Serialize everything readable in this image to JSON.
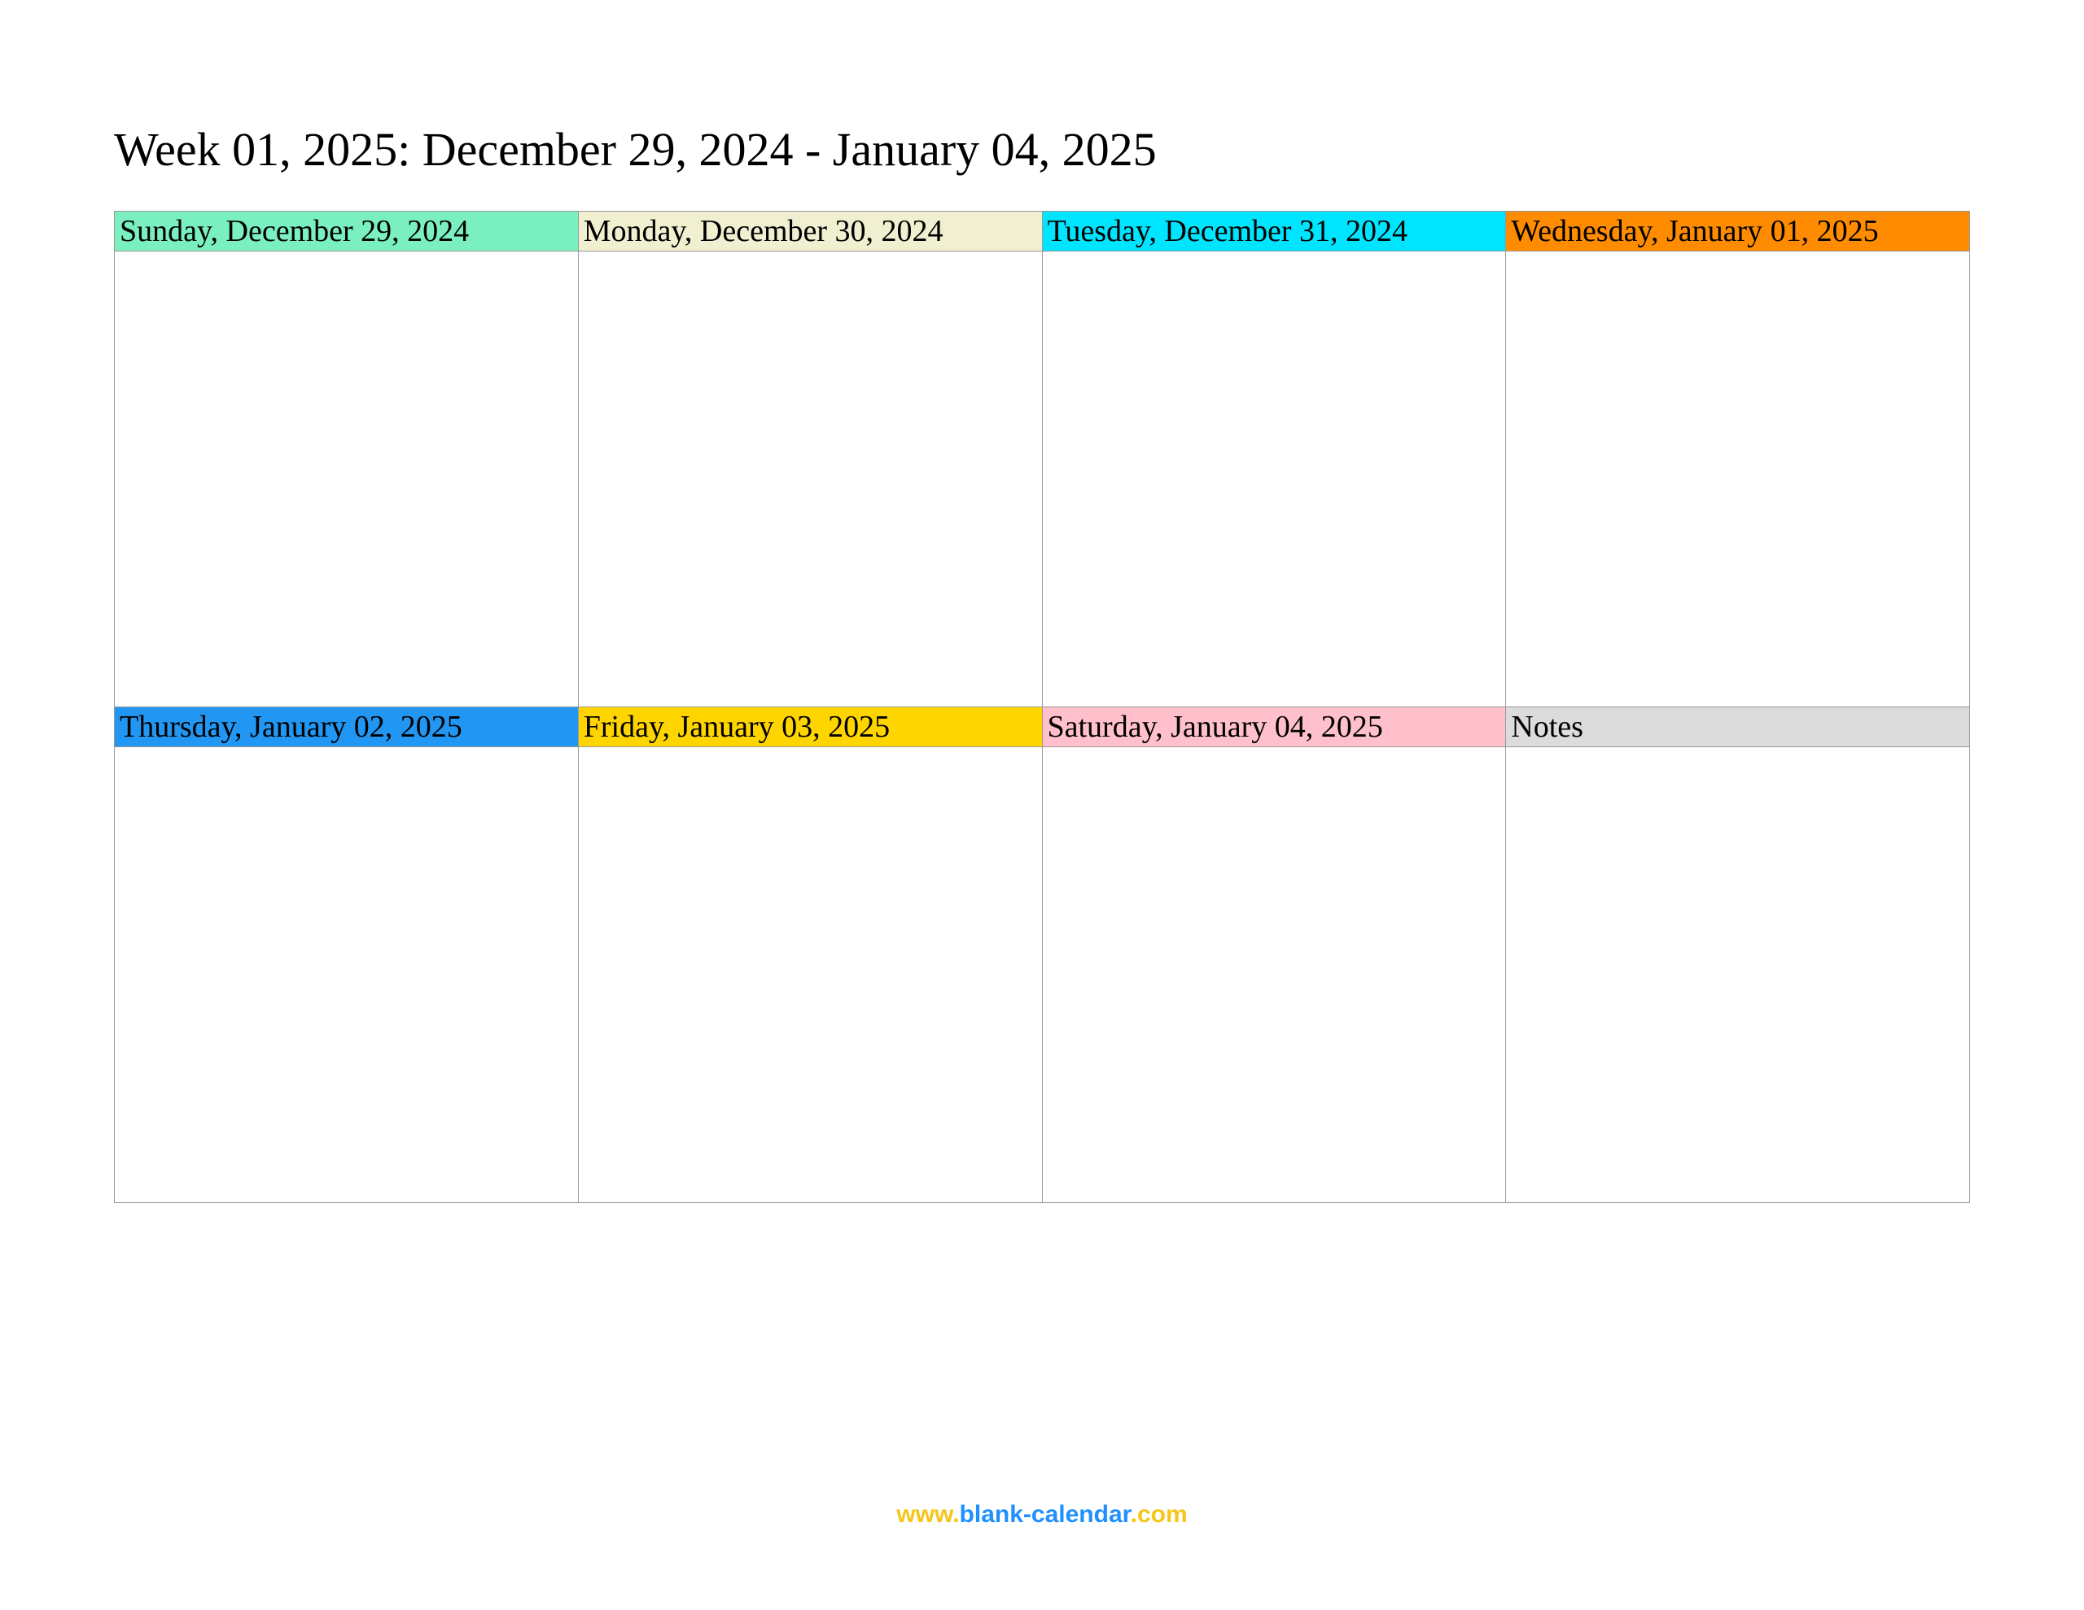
{
  "title": "Week 01, 2025: December 29, 2024 - January 04, 2025",
  "cells": {
    "sunday": "Sunday, December 29, 2024",
    "monday": "Monday, December 30, 2024",
    "tuesday": "Tuesday, December 31, 2024",
    "wednesday": "Wednesday, January 01, 2025",
    "thursday": "Thursday, January 02, 2025",
    "friday": "Friday, January 03, 2025",
    "saturday": "Saturday, January 04, 2025",
    "notes": "Notes"
  },
  "footer": {
    "www": "www",
    "dot1": ".",
    "blank": "blank",
    "dash": "-",
    "calendar": "calendar",
    "dot2": ".",
    "com": "com"
  }
}
